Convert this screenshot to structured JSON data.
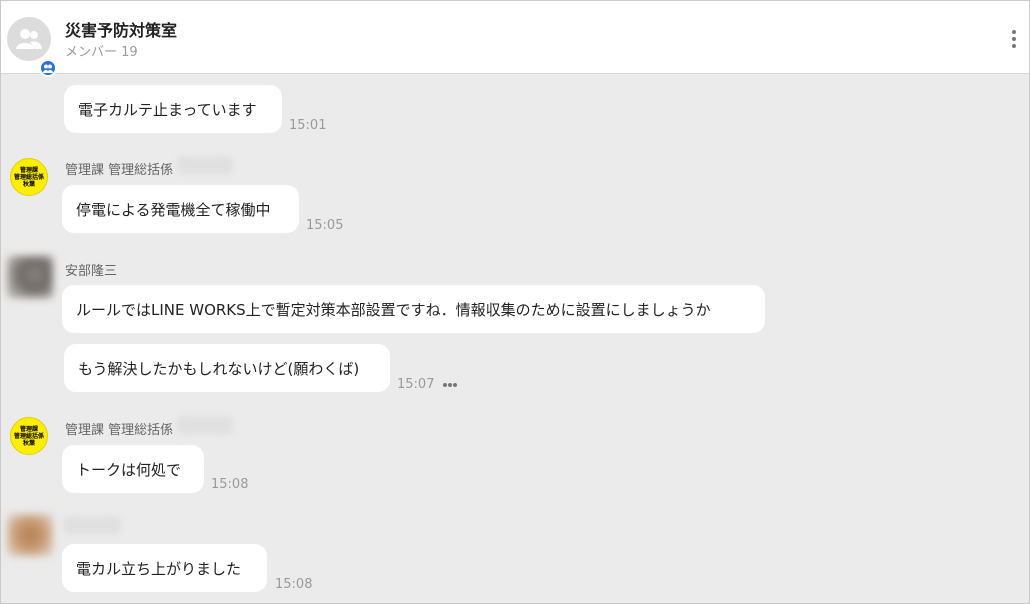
{
  "header": {
    "title": "災害予防対策室",
    "member_count": "メンバー 19",
    "avatar_icon": "group-people-icon",
    "menu_icon": "more-vertical-icon"
  },
  "colors": {
    "background": "#ebebeb",
    "bubble": "#ffffff",
    "badge": "#2d6fd6",
    "yellow_avatar": "#ffee00"
  },
  "messages": [
    {
      "sender": "",
      "text": "電子カルテ止まっています",
      "time": "15:01"
    },
    {
      "sender": "管理課 管理総括係",
      "avatar_text": [
        "管理課",
        "管理総括係",
        "秋葉"
      ],
      "text": "停電による発電機全て稼働中",
      "time": "15:05"
    },
    {
      "sender": "安部隆三",
      "text": "ルールではLINE WORKS上で暫定対策本部設置ですね．情報収集のために設置にしましょうか",
      "time": ""
    },
    {
      "sender": "",
      "text": "もう解決したかもしれないけど(願わくば)",
      "time": "15:07"
    },
    {
      "sender": "管理課 管理総括係",
      "avatar_text": [
        "管理課",
        "管理総括係",
        "秋葉"
      ],
      "text": "トークは何処で",
      "time": "15:08"
    },
    {
      "sender": "",
      "text": "電カル立ち上がりました",
      "time": "15:08"
    }
  ]
}
